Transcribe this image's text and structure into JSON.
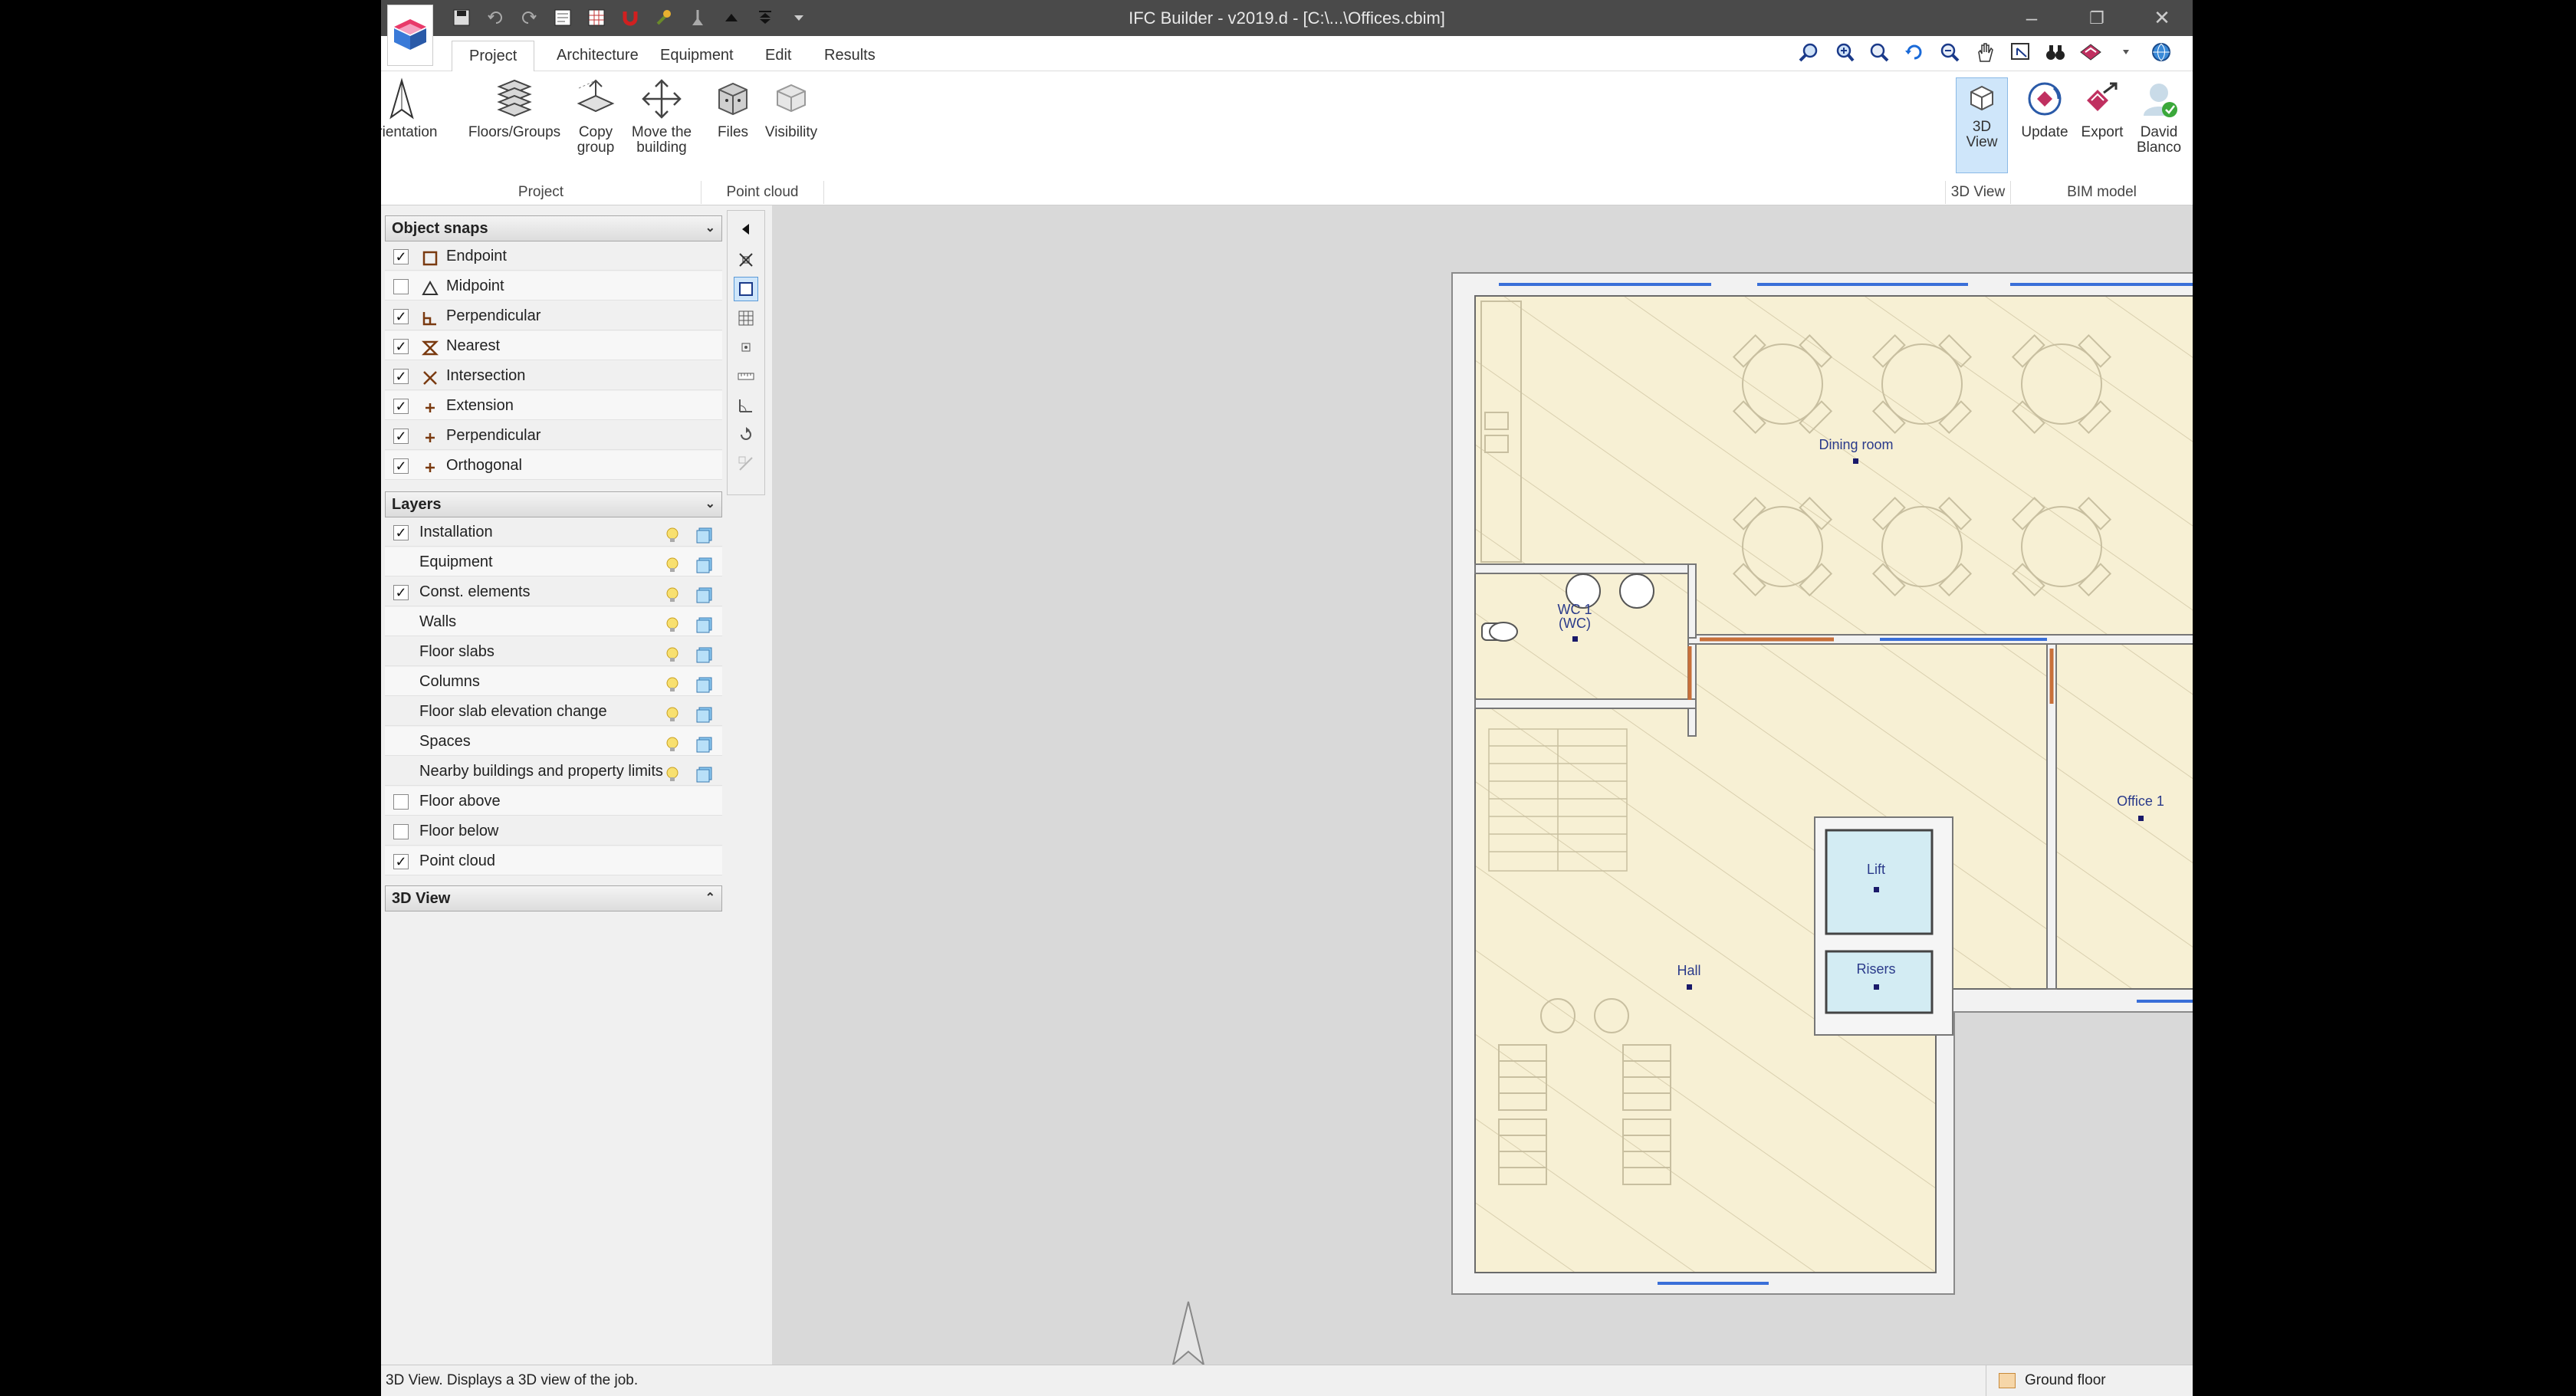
{
  "window": {
    "title": "IFC Builder - v2019.d - [C:\\...\\Offices.cbim]"
  },
  "tabs": [
    {
      "label": "Project",
      "active": true
    },
    {
      "label": "Architecture",
      "active": false
    },
    {
      "label": "Equipment",
      "active": false
    },
    {
      "label": "Edit",
      "active": false
    },
    {
      "label": "Results",
      "active": false
    }
  ],
  "ribbon": {
    "project_group": "Project",
    "pointcloud_group": "Point cloud",
    "view3d_group": "3D View",
    "bim_group": "BIM model",
    "buttons": {
      "orientation": "Orientation",
      "floors_groups": "Floors/Groups",
      "copy_group_1": "Copy",
      "copy_group_2": "group",
      "move_building_1": "Move the",
      "move_building_2": "building",
      "files": "Files",
      "visibility": "Visibility",
      "view3d_1": "3D",
      "view3d_2": "View",
      "update": "Update",
      "export": "Export",
      "user_1": "David",
      "user_2": "Blanco"
    }
  },
  "object_snaps": {
    "header": "Object snaps",
    "items": [
      {
        "label": "Endpoint",
        "checked": true,
        "icon": "square-snap-icon"
      },
      {
        "label": "Midpoint",
        "checked": false,
        "icon": "triangle-snap-icon"
      },
      {
        "label": "Perpendicular",
        "checked": true,
        "icon": "perpendicular-snap-icon"
      },
      {
        "label": "Nearest",
        "checked": true,
        "icon": "hourglass-snap-icon"
      },
      {
        "label": "Intersection",
        "checked": true,
        "icon": "x-snap-icon"
      },
      {
        "label": "Extension",
        "checked": true,
        "icon": "plus-snap-icon"
      },
      {
        "label": "Perpendicular",
        "checked": true,
        "icon": "plus-snap-icon"
      },
      {
        "label": "Orthogonal",
        "checked": true,
        "icon": "plus-snap-icon"
      }
    ]
  },
  "layers": {
    "header": "Layers",
    "items": [
      {
        "label": "Installation",
        "checked": true,
        "has_checkbox": true,
        "has_tools": true
      },
      {
        "label": "Equipment",
        "checked": false,
        "has_checkbox": false,
        "has_tools": true
      },
      {
        "label": "Const. elements",
        "checked": true,
        "has_checkbox": true,
        "has_tools": true
      },
      {
        "label": "Walls",
        "checked": false,
        "has_checkbox": false,
        "has_tools": true
      },
      {
        "label": "Floor slabs",
        "checked": false,
        "has_checkbox": false,
        "has_tools": true
      },
      {
        "label": "Columns",
        "checked": false,
        "has_checkbox": false,
        "has_tools": true
      },
      {
        "label": "Floor slab elevation change",
        "checked": false,
        "has_checkbox": false,
        "has_tools": true
      },
      {
        "label": "Spaces",
        "checked": false,
        "has_checkbox": false,
        "has_tools": true
      },
      {
        "label": "Nearby buildings and property limits",
        "checked": false,
        "has_checkbox": false,
        "has_tools": true
      },
      {
        "label": "Floor above",
        "checked": false,
        "has_checkbox": true,
        "has_tools": false
      },
      {
        "label": "Floor below",
        "checked": false,
        "has_checkbox": true,
        "has_tools": false
      },
      {
        "label": "Point cloud",
        "checked": true,
        "has_checkbox": true,
        "has_tools": false
      }
    ]
  },
  "view3d_section": {
    "header": "3D View"
  },
  "plan": {
    "rooms": {
      "dining": "Dining room",
      "wc_1": "WC 1",
      "wc_2": "(WC)",
      "office": "Office 1",
      "lift": "Lift",
      "risers": "Risers",
      "hall": "Hall"
    }
  },
  "status": {
    "message": "3D View. Displays a 3D view of the job.",
    "floor": "Ground floor"
  },
  "colors": {
    "titlebar": "#4a4a4a",
    "floor_fill": "#f7f0d4",
    "wall_fill": "#f2f2f2",
    "window_blue": "#3a6fd8",
    "door_orange": "#c8703a",
    "lift_fill": "#d3ecf3"
  }
}
